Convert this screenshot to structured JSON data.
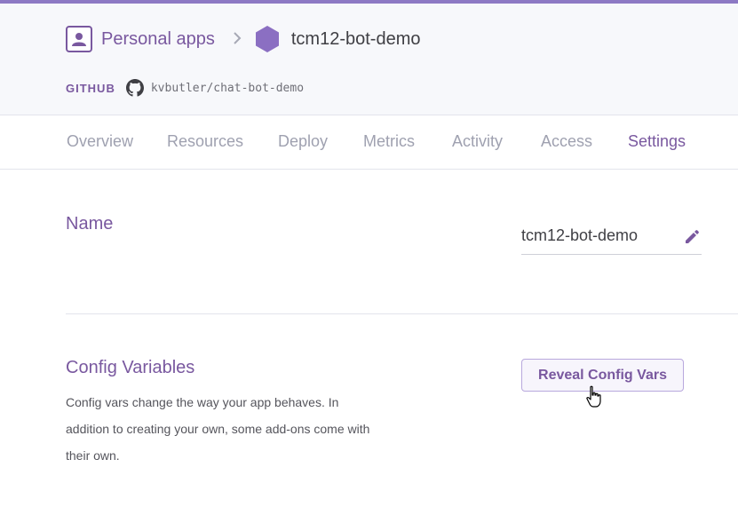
{
  "colors": {
    "accent": "#79589f",
    "top_bar": "#8d79c4",
    "tab_inactive": "#9fa1b0"
  },
  "breadcrumb": {
    "parent_icon": "person-icon",
    "parent_label": "Personal apps",
    "separator_icon": "chevron-right-icon",
    "app_icon": "hexagon-icon",
    "app_name": "tcm12-bot-demo"
  },
  "github": {
    "label": "GITHUB",
    "icon": "github-icon",
    "repo": "kvbutler/chat-bot-demo"
  },
  "tabs": [
    {
      "label": "Overview",
      "active": false
    },
    {
      "label": "Resources",
      "active": false
    },
    {
      "label": "Deploy",
      "active": false
    },
    {
      "label": "Metrics",
      "active": false
    },
    {
      "label": "Activity",
      "active": false
    },
    {
      "label": "Access",
      "active": false
    },
    {
      "label": "Settings",
      "active": true
    }
  ],
  "name_section": {
    "title": "Name",
    "value": "tcm12-bot-demo",
    "edit_icon": "pencil-icon"
  },
  "config_section": {
    "title": "Config Variables",
    "description": "Config vars change the way your app behaves. In addition to creating your own, some add-ons come with their own.",
    "button_label": "Reveal Config Vars"
  }
}
